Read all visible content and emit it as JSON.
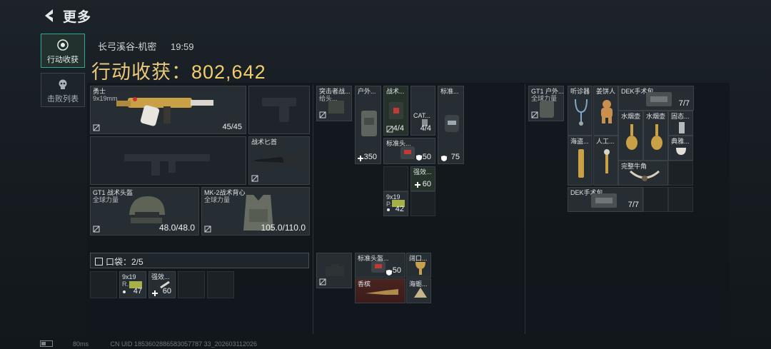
{
  "header": {
    "title": "更多"
  },
  "tabs": [
    {
      "label": "行动收获",
      "active": true,
      "icon": "eye-target-icon"
    },
    {
      "label": "击败列表",
      "active": false,
      "icon": "skull-icon"
    }
  ],
  "meta": {
    "map": "长弓溪谷-机密",
    "time": "19:59"
  },
  "harvest": {
    "label": "行动收获：",
    "value": "802,642"
  },
  "loadout": {
    "primary": {
      "name": "勇士",
      "ammo": "9x19mm",
      "count": "45/45"
    },
    "knife": {
      "name": "战术匕首"
    },
    "helmet": {
      "name": "GT1 战术头盔",
      "brand": "全球力量",
      "durability": "48.0/48.0"
    },
    "armor": {
      "name": "MK-2战术背心",
      "brand": "全球力量",
      "durability": "105.0/110.0"
    },
    "pocket": {
      "label": "口袋：2/5"
    },
    "pocket_items": [
      {
        "name": "9x19",
        "sub": "R...",
        "count": "47"
      },
      {
        "name": "强效...",
        "count": "60"
      }
    ]
  },
  "chest": {
    "rig": {
      "name": "突击者战...",
      "sub": "给头..."
    },
    "items": [
      {
        "name": "户外...",
        "count": "350"
      },
      {
        "name": "战术...",
        "count": "4/4"
      },
      {
        "name": "CAT...",
        "count": "4/4"
      },
      {
        "name": "标准...",
        "count": "75"
      },
      {
        "name": "标准头...",
        "count": "50"
      },
      {
        "name": "强效...",
        "count": "60"
      },
      {
        "name": "9x19",
        "sub": "P...",
        "count": "42"
      }
    ]
  },
  "bag": {
    "items": [
      {
        "name": "标准头盔...",
        "count": "50"
      },
      {
        "name": "阔口..."
      },
      {
        "name": "香槟"
      },
      {
        "name": "海蛎..."
      }
    ]
  },
  "backpack": {
    "rig": {
      "name": "GT1 户外...",
      "brand": "全球力量"
    },
    "items": [
      {
        "name": "听诊器"
      },
      {
        "name": "姜饼人"
      },
      {
        "name": "DEK手术包",
        "count": "7/7"
      },
      {
        "name": "水烟壶"
      },
      {
        "name": "水烟壶"
      },
      {
        "name": "固态..."
      },
      {
        "name": "海盗..."
      },
      {
        "name": "人工..."
      },
      {
        "name": "典雅..."
      },
      {
        "name": "完整牛角"
      },
      {
        "name": "DEK手术包",
        "count": "7/7"
      }
    ]
  },
  "footer": {
    "ping": "80ms",
    "uid": "CN UID 1853602886583057787 33_202603112026"
  }
}
